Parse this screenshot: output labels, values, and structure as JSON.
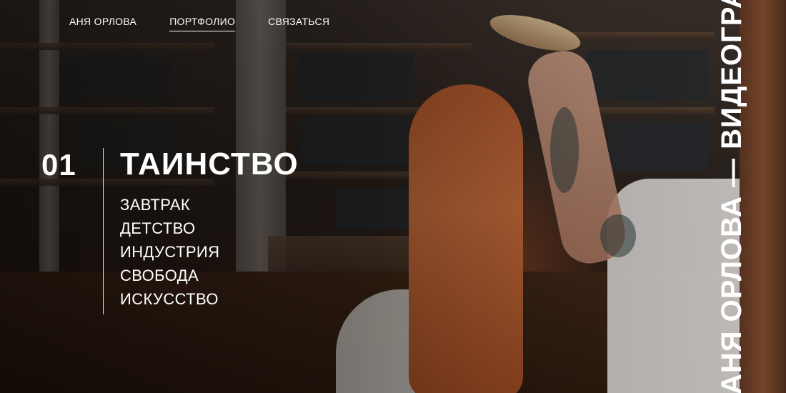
{
  "nav": {
    "items": [
      {
        "label": "АНЯ ОРЛОВА",
        "active": false
      },
      {
        "label": "ПОРТФОЛИО",
        "active": true
      },
      {
        "label": "СВЯЗАТЬСЯ",
        "active": false
      }
    ]
  },
  "project": {
    "number": "01",
    "title": "ТАИНСТВО",
    "items": [
      "ЗАВТРАК",
      "ДЕТСТВО",
      "ИНДУСТРИЯ",
      "СВОБОДА",
      "ИСКУССТВО"
    ]
  },
  "tagline": "АНЯ ОРЛОВА — ВИДЕОГРАФ",
  "colors": {
    "text": "#ffffff",
    "overlay": "#000000"
  }
}
